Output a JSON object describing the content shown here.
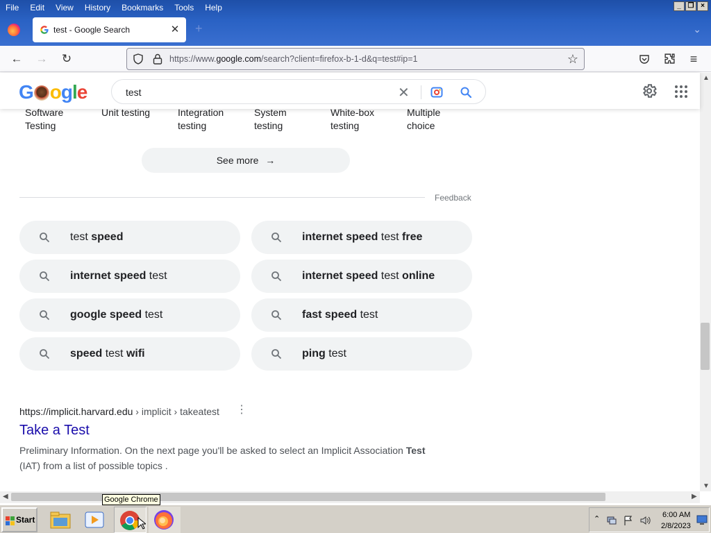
{
  "browser": {
    "menu": [
      "File",
      "Edit",
      "View",
      "History",
      "Bookmarks",
      "Tools",
      "Help"
    ],
    "tab_title": "test - Google Search",
    "url_prefix": "https://www.",
    "url_domain": "google.com",
    "url_rest": "/search?client=firefox-b-1-d&q=test#ip=1"
  },
  "google": {
    "logo_text": "Google",
    "query": "test"
  },
  "topics": [
    {
      "line1": "Software",
      "line2": "Testing"
    },
    {
      "line1": "Unit testing",
      "line2": ""
    },
    {
      "line1": "Integration",
      "line2": "testing"
    },
    {
      "line1": "System",
      "line2": "testing"
    },
    {
      "line1": "White-box",
      "line2": "testing"
    },
    {
      "line1": "Multiple",
      "line2": "choice"
    }
  ],
  "see_more_label": "See more",
  "feedback_label": "Feedback",
  "related_searches": [
    [
      {
        "t": "test ",
        "b": false
      },
      {
        "t": "speed",
        "b": true
      }
    ],
    [
      {
        "t": "internet speed",
        "b": true
      },
      {
        "t": " test ",
        "b": false
      },
      {
        "t": "free",
        "b": true
      }
    ],
    [
      {
        "t": "internet speed",
        "b": true
      },
      {
        "t": " test",
        "b": false
      }
    ],
    [
      {
        "t": "internet speed",
        "b": true
      },
      {
        "t": " test ",
        "b": false
      },
      {
        "t": "online",
        "b": true
      }
    ],
    [
      {
        "t": "google speed",
        "b": true
      },
      {
        "t": " test",
        "b": false
      }
    ],
    [
      {
        "t": "fast speed",
        "b": true
      },
      {
        "t": " test",
        "b": false
      }
    ],
    [
      {
        "t": "speed",
        "b": true
      },
      {
        "t": " test ",
        "b": false
      },
      {
        "t": "wifi",
        "b": true
      }
    ],
    [
      {
        "t": "ping",
        "b": true
      },
      {
        "t": " test",
        "b": false
      }
    ]
  ],
  "result": {
    "url_host": "https://implicit.harvard.edu",
    "url_path": " › implicit › takeatest",
    "title": "Take a Test",
    "snippet_before": "Preliminary Information. On the next page you'll be asked to select an Implicit Association ",
    "snippet_bold": "Test",
    "snippet_after": " (IAT) from a list of possible topics ."
  },
  "taskbar": {
    "start_label": "Start",
    "tooltip": "Google Chrome",
    "time": "6:00 AM",
    "date": "2/8/2023"
  }
}
